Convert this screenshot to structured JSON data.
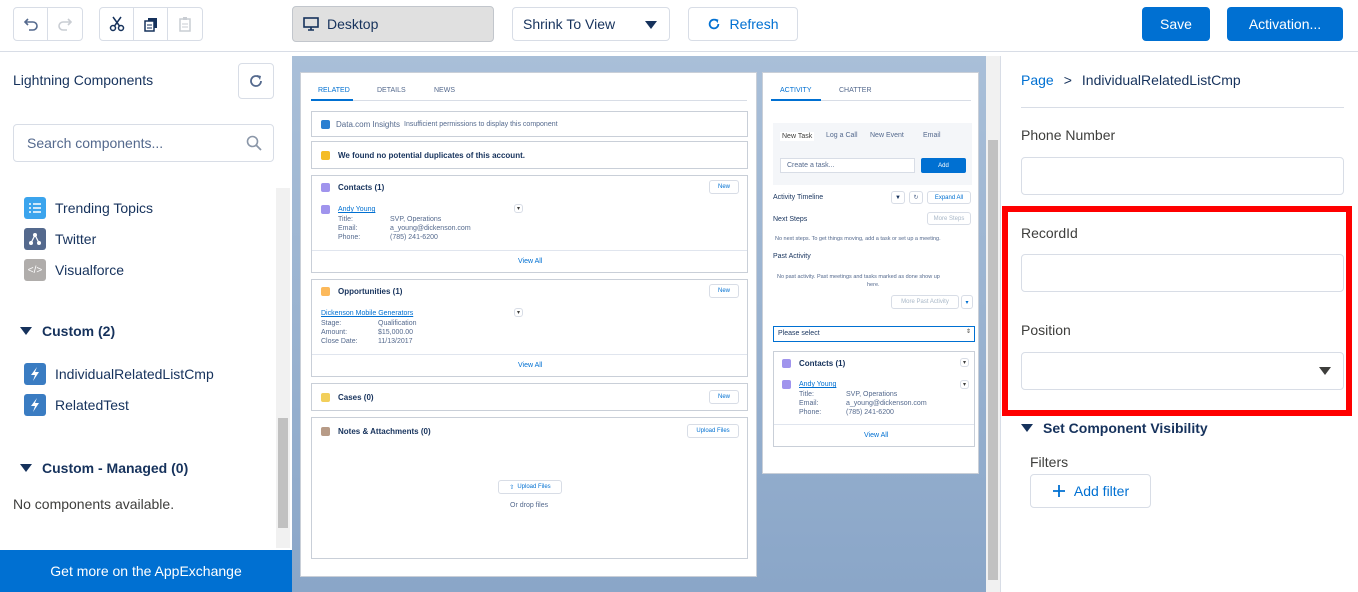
{
  "toolbar": {
    "undo_icon": "undo-icon",
    "redo_icon": "redo-icon",
    "cut_icon": "cut-icon",
    "copy_icon": "copy-icon",
    "paste_icon": "paste-icon",
    "device": "Desktop",
    "view_mode": "Shrink To View",
    "refresh": "Refresh",
    "save": "Save",
    "activation": "Activation..."
  },
  "left_panel": {
    "title": "Lightning Components",
    "search_placeholder": "Search components...",
    "standard_items": [
      {
        "label": "Trending Topics",
        "icon": "list-icon",
        "color": "#3ba4ed"
      },
      {
        "label": "Twitter",
        "icon": "share-icon",
        "color": "#54698d"
      },
      {
        "label": "Visualforce",
        "icon": "code-icon",
        "color": "#b0adab"
      }
    ],
    "custom_header": "Custom (2)",
    "custom_items": [
      {
        "label": "IndividualRelatedListCmp",
        "icon": "lightning-icon",
        "color": "#3a7cc2"
      },
      {
        "label": "RelatedTest",
        "icon": "lightning-icon",
        "color": "#3a7cc2"
      }
    ],
    "managed_header": "Custom - Managed (0)",
    "no_components": "No components available.",
    "appexchange": "Get more on the AppExchange"
  },
  "preview": {
    "left_tabs": [
      "RELATED",
      "DETAILS",
      "NEWS"
    ],
    "insights_title": "Data.com Insights",
    "insights_msg": "Insufficient permissions to display this component",
    "duplicates_msg": "We found no potential duplicates of this account.",
    "contacts": {
      "title": "Contacts (1)",
      "new": "New",
      "name": "Andy Young",
      "fields": [
        {
          "label": "Title:",
          "value": "SVP, Operations"
        },
        {
          "label": "Email:",
          "value": "a_young@dickenson.com"
        },
        {
          "label": "Phone:",
          "value": "(785) 241-6200"
        }
      ],
      "view_all": "View All"
    },
    "opportunities": {
      "title": "Opportunities (1)",
      "new": "New",
      "name": "Dickenson Mobile Generators",
      "fields": [
        {
          "label": "Stage:",
          "value": "Qualification"
        },
        {
          "label": "Amount:",
          "value": "$15,000.00"
        },
        {
          "label": "Close Date:",
          "value": "11/13/2017"
        }
      ],
      "view_all": "View All"
    },
    "cases": {
      "title": "Cases (0)",
      "new": "New"
    },
    "notes": {
      "title": "Notes & Attachments (0)",
      "upload": "Upload Files",
      "upload_btn": "Upload Files",
      "drop": "Or drop files"
    },
    "right_tabs": [
      "ACTIVITY",
      "CHATTER"
    ],
    "activity_tabs": [
      "New Task",
      "Log a Call",
      "New Event",
      "Email"
    ],
    "create_task": "Create a task...",
    "add": "Add",
    "timeline": "Activity Timeline",
    "expand_all": "Expand All",
    "next_steps": "Next Steps",
    "more_steps": "More Steps",
    "next_steps_msg": "No next steps. To get things moving, add a task or set up a meeting.",
    "past_activity": "Past Activity",
    "past_msg_1": "No past activity. Past meetings and tasks marked as done show up",
    "past_msg_2": "here.",
    "more_past": "More Past Activity",
    "please_select": "Please select",
    "r_contacts": {
      "title": "Contacts (1)",
      "name": "Andy Young",
      "fields": [
        {
          "label": "Title:",
          "value": "SVP, Operations"
        },
        {
          "label": "Email:",
          "value": "a_young@dickenson.com"
        },
        {
          "label": "Phone:",
          "value": "(785) 241-6200"
        }
      ],
      "view_all": "View All"
    }
  },
  "right_panel": {
    "crumb_page": "Page",
    "crumb_sep": ">",
    "crumb_current": "IndividualRelatedListCmp",
    "phone_label": "Phone Number",
    "phone_value": "",
    "recordid_label": "RecordId",
    "recordid_value": "",
    "position_label": "Position",
    "position_value": "",
    "visibility_header": "Set Component Visibility",
    "filters_label": "Filters",
    "add_filter": "Add filter"
  },
  "colors": {
    "brand": "#0070d2",
    "highlight": "#ff0000",
    "text": "#16325c"
  }
}
